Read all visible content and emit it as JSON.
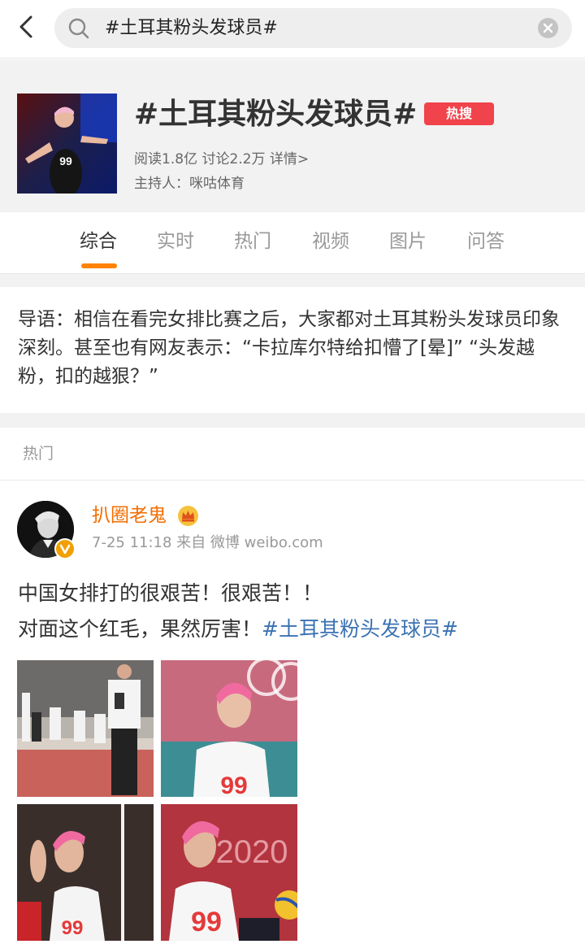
{
  "search": {
    "query": "#土耳其粉头发球员#"
  },
  "topic": {
    "title": "#土耳其粉头发球员#",
    "badge": "热搜",
    "stats": "阅读1.8亿 讨论2.2万 详情>",
    "host": "主持人：咪咕体育",
    "thumb_jersey_number": "99"
  },
  "tabs": [
    {
      "label": "综合",
      "active": true
    },
    {
      "label": "实时",
      "active": false
    },
    {
      "label": "热门",
      "active": false
    },
    {
      "label": "视频",
      "active": false
    },
    {
      "label": "图片",
      "active": false
    },
    {
      "label": "问答",
      "active": false
    }
  ],
  "intro": {
    "text": "导语：相信在看完女排比赛之后，大家都对土耳其粉头发球员印象深刻。甚至也有网友表示：“卡拉库尔特给扣懵了[晕]” “头发越粉，扣的越狠？”"
  },
  "section": {
    "label": "热门"
  },
  "post": {
    "username": "扒圈老鬼",
    "meta": "7-25 11:18  来自 微博 weibo.com",
    "line1": "中国女排打的很艰苦！很艰苦！！",
    "line2": "对面这个红毛，果然厉害！",
    "hashtag": "#土耳其粉头发球员#",
    "photo_texts": {
      "p2_number": "99",
      "p3_number": "99",
      "p4_year": "2020",
      "p4_number": "99"
    }
  },
  "colors": {
    "accent_orange": "#ff8200",
    "username": "#f26d00",
    "hashtag": "#3b72b3",
    "hot_badge": "#f1434b",
    "header_bg": "#f2f2f2"
  },
  "icons": {
    "back": "chevron-left-icon",
    "search": "search-icon",
    "clear": "clear-icon",
    "crown": "crown-icon",
    "verified": "verified-badge-icon"
  }
}
